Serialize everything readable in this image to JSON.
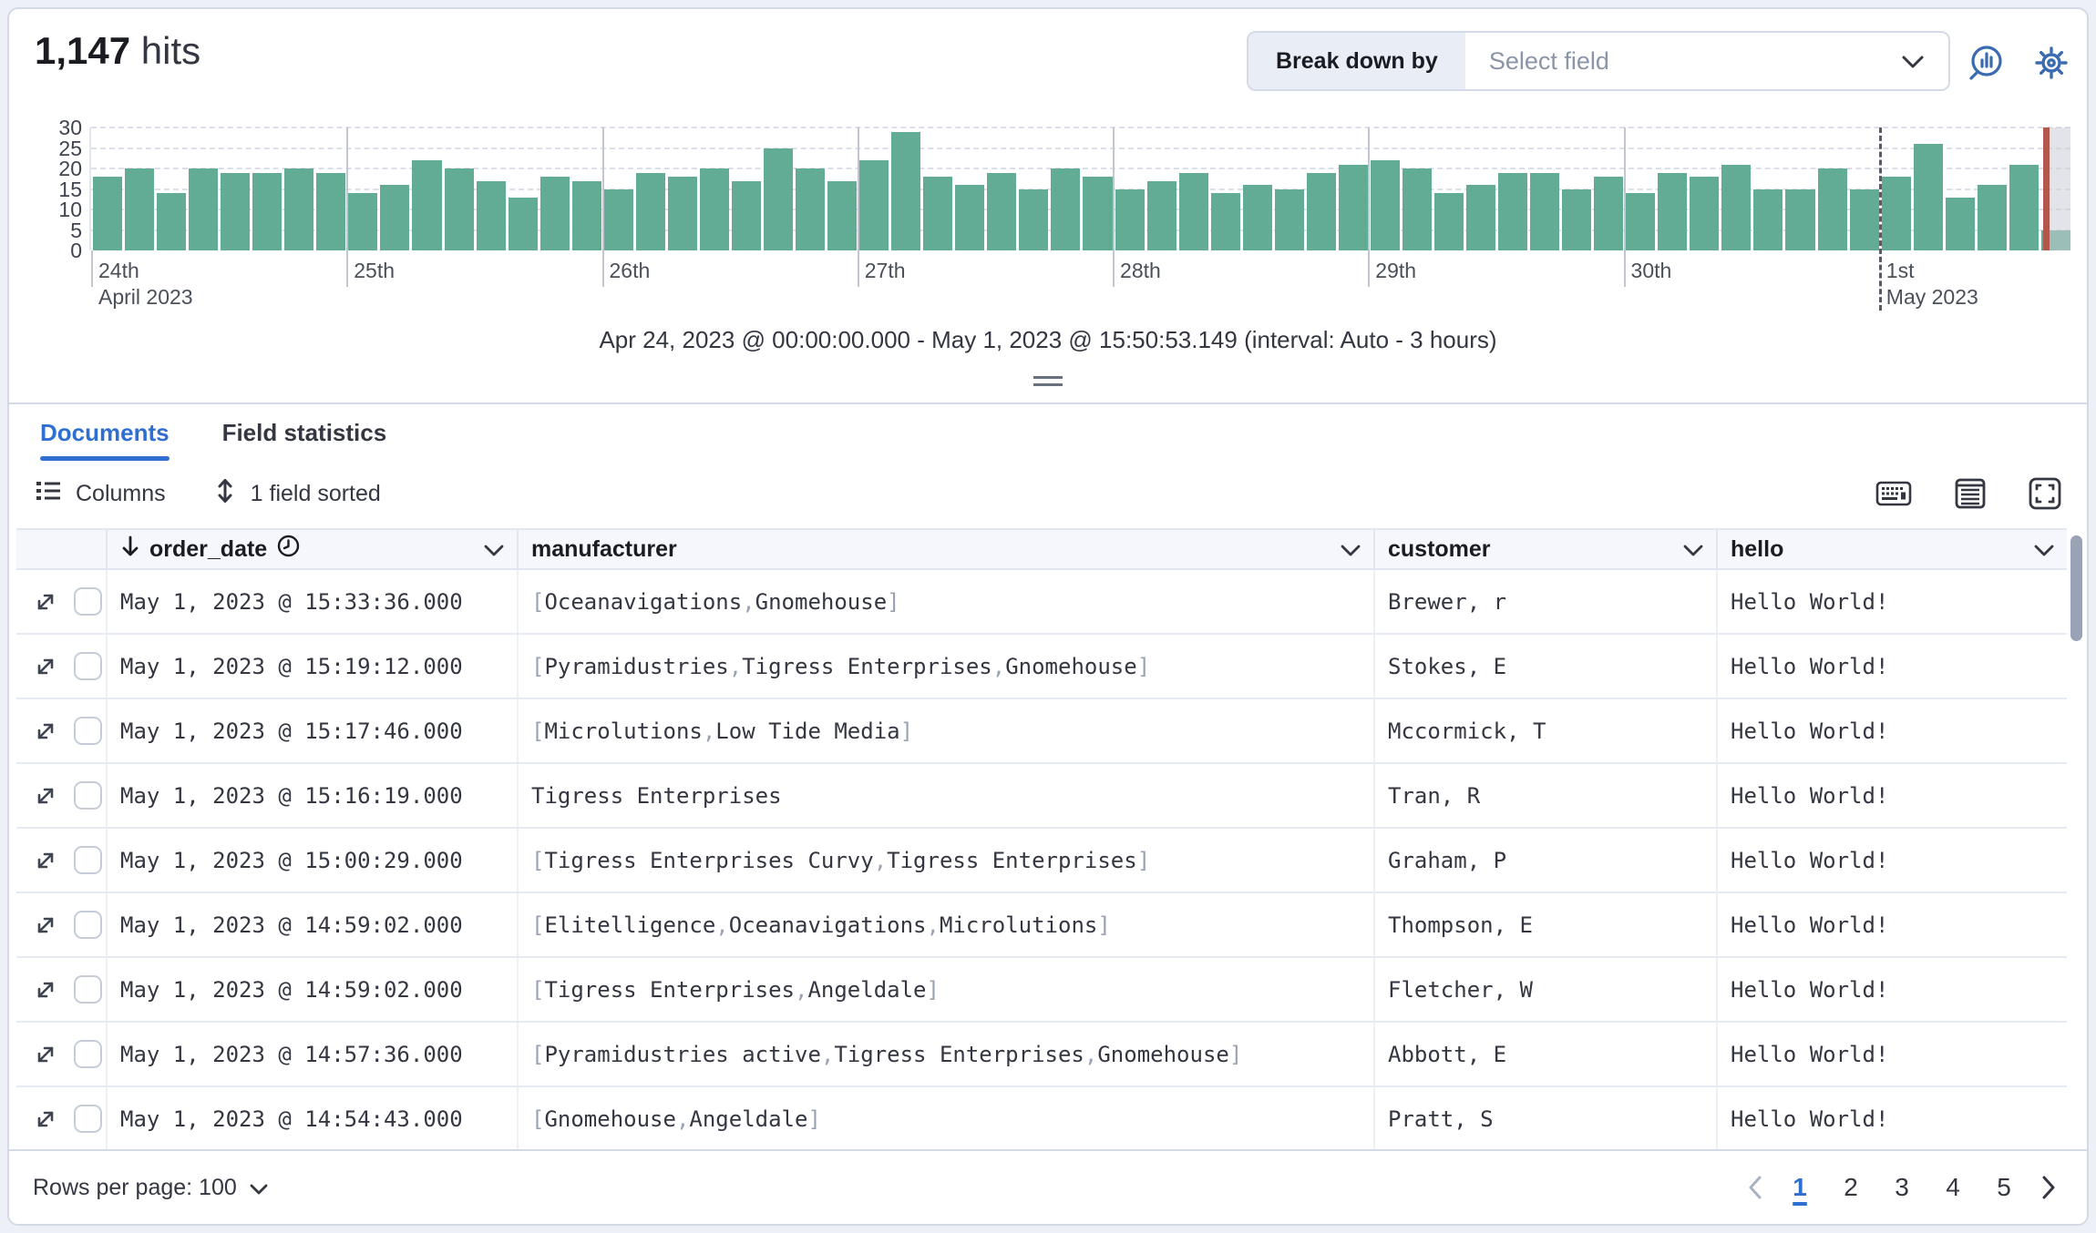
{
  "header": {
    "hits_count": "1,147",
    "hits_label": "hits",
    "breakdown_label": "Break down by",
    "breakdown_placeholder": "Select field",
    "top_icons": [
      "visualization-icon",
      "gear-icon"
    ]
  },
  "ui_colors": {
    "accent_blue": "#2e6fd1",
    "icon_blue": "#3a6bb0",
    "bar_green": "#62ab95",
    "marker_red": "#b3564e",
    "border_gray": "#d3dae6"
  },
  "chart_data": {
    "type": "bar",
    "title": "",
    "xlabel": "",
    "ylabel": "",
    "ylim": [
      0,
      30
    ],
    "yticks": [
      0,
      5,
      10,
      15,
      20,
      25,
      30
    ],
    "grid": "dashed-horizontal",
    "legend": false,
    "x_start": "Apr 24, 2023 @ 00:00:00.000",
    "x_end": "May 1, 2023 @ 15:50:53.149",
    "interval": "Auto - 3 hours",
    "bars_per_day": 8,
    "bar_color": "#62ab95",
    "marker_color": "#b3564e",
    "current_time_marker": true,
    "day_labels": [
      {
        "label": "24th",
        "sub": "April 2023"
      },
      {
        "label": "25th",
        "sub": ""
      },
      {
        "label": "26th",
        "sub": ""
      },
      {
        "label": "27th",
        "sub": ""
      },
      {
        "label": "28th",
        "sub": ""
      },
      {
        "label": "29th",
        "sub": ""
      },
      {
        "label": "30th",
        "sub": ""
      },
      {
        "label": "1st",
        "sub": "May 2023"
      }
    ],
    "values": [
      18,
      20,
      14,
      20,
      19,
      19,
      20,
      19,
      14,
      16,
      22,
      20,
      17,
      13,
      18,
      17,
      15,
      19,
      18,
      20,
      17,
      25,
      20,
      17,
      22,
      29,
      18,
      16,
      19,
      15,
      20,
      18,
      15,
      17,
      19,
      14,
      16,
      15,
      19,
      21,
      22,
      20,
      14,
      16,
      19,
      19,
      15,
      18,
      14,
      19,
      18,
      21,
      15,
      15,
      20,
      15,
      18,
      26,
      13,
      16,
      21,
      5
    ]
  },
  "chart_caption": "Apr 24, 2023 @ 00:00:00.000 - May 1, 2023 @ 15:50:53.149 (interval: Auto - 3 hours)",
  "tabs": [
    {
      "label": "Documents",
      "active": true
    },
    {
      "label": "Field statistics",
      "active": false
    }
  ],
  "toolbar": {
    "columns_label": "Columns",
    "sorted_label": "1 field sorted",
    "right_icons": [
      "keyboard-icon",
      "table-density-icon",
      "fullscreen-icon"
    ]
  },
  "table": {
    "columns": [
      {
        "name": "order_date",
        "sorted": "desc",
        "has_clock_icon": true
      },
      {
        "name": "manufacturer"
      },
      {
        "name": "customer"
      },
      {
        "name": "hello"
      }
    ],
    "rows": [
      {
        "order_date": "May 1, 2023 @ 15:33:36.000",
        "manufacturer": [
          "Oceanavigations",
          "Gnomehouse"
        ],
        "customer": "Brewer, r",
        "hello": "Hello World!"
      },
      {
        "order_date": "May 1, 2023 @ 15:19:12.000",
        "manufacturer": [
          "Pyramidustries",
          "Tigress Enterprises",
          "Gnomehouse"
        ],
        "customer": "Stokes, E",
        "hello": "Hello World!"
      },
      {
        "order_date": "May 1, 2023 @ 15:17:46.000",
        "manufacturer": [
          "Microlutions",
          "Low Tide Media"
        ],
        "customer": "Mccormick, T",
        "hello": "Hello World!"
      },
      {
        "order_date": "May 1, 2023 @ 15:16:19.000",
        "manufacturer": "Tigress Enterprises",
        "customer": "Tran, R",
        "hello": "Hello World!"
      },
      {
        "order_date": "May 1, 2023 @ 15:00:29.000",
        "manufacturer": [
          "Tigress Enterprises Curvy",
          "Tigress Enterprises"
        ],
        "customer": "Graham, P",
        "hello": "Hello World!"
      },
      {
        "order_date": "May 1, 2023 @ 14:59:02.000",
        "manufacturer": [
          "Elitelligence",
          "Oceanavigations",
          "Microlutions"
        ],
        "customer": "Thompson, E",
        "hello": "Hello World!"
      },
      {
        "order_date": "May 1, 2023 @ 14:59:02.000",
        "manufacturer": [
          "Tigress Enterprises",
          "Angeldale"
        ],
        "customer": "Fletcher, W",
        "hello": "Hello World!"
      },
      {
        "order_date": "May 1, 2023 @ 14:57:36.000",
        "manufacturer": [
          "Pyramidustries active",
          "Tigress Enterprises",
          "Gnomehouse"
        ],
        "customer": "Abbott, E",
        "hello": "Hello World!"
      },
      {
        "order_date": "May 1, 2023 @ 14:54:43.000",
        "manufacturer": [
          "Gnomehouse",
          "Angeldale"
        ],
        "customer": "Pratt, S",
        "hello": "Hello World!"
      }
    ]
  },
  "footer": {
    "rows_per_page_label": "Rows per page: 100",
    "pages": [
      "1",
      "2",
      "3",
      "4",
      "5"
    ],
    "current_page": "1"
  }
}
